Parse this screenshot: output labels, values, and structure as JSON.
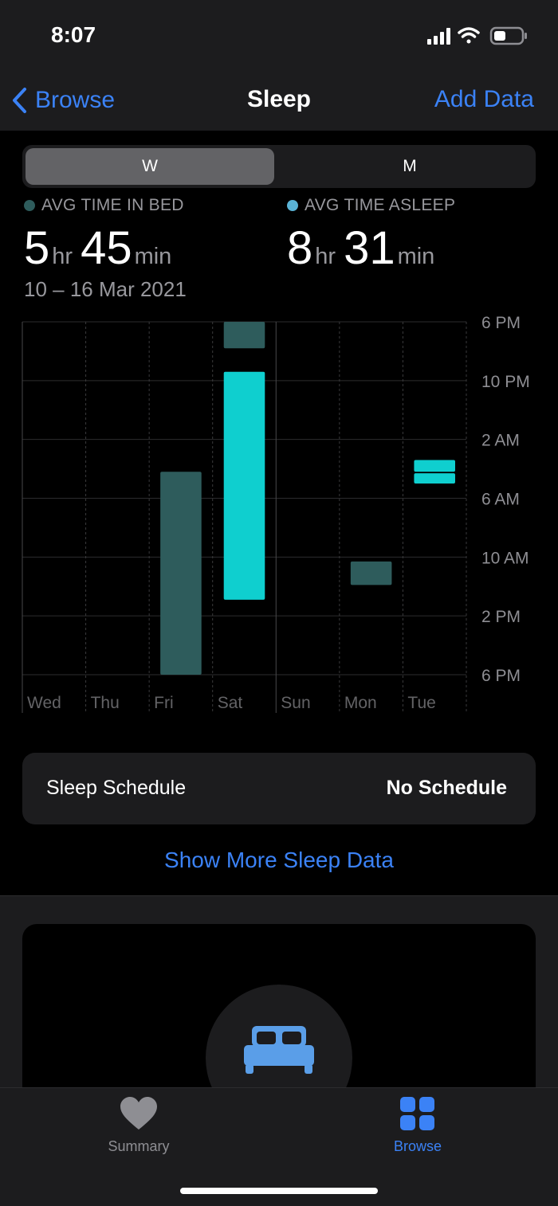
{
  "status": {
    "time": "8:07"
  },
  "nav": {
    "back_label": "Browse",
    "title": "Sleep",
    "action_label": "Add Data"
  },
  "segment": {
    "week": "W",
    "month": "M"
  },
  "stats": {
    "in_bed": {
      "label": "AVG TIME IN BED",
      "hours": "5",
      "hours_unit": "hr",
      "minutes": "45",
      "minutes_unit": "min",
      "color": "#2e5c5c"
    },
    "asleep": {
      "label": "AVG TIME ASLEEP",
      "hours": "8",
      "hours_unit": "hr",
      "minutes": "31",
      "minutes_unit": "min",
      "color": "#5ab3d6"
    }
  },
  "date_range": "10 – 16 Mar 2021",
  "chart_data": {
    "type": "bar",
    "categories": [
      "Wed",
      "Thu",
      "Fri",
      "Sat",
      "Sun",
      "Mon",
      "Tue"
    ],
    "y_ticks": [
      "6 PM",
      "10 PM",
      "2 AM",
      "6 AM",
      "10 AM",
      "2 PM",
      "6 PM"
    ],
    "y_range_hours_from_6pm": [
      0,
      24
    ],
    "series": [
      {
        "color": "#2e5c5c",
        "bars": [
          {
            "day": "Fri",
            "start": 10.2,
            "end": 24
          },
          {
            "day": "Sat",
            "start": 0,
            "end": 1.8
          },
          {
            "day": "Mon",
            "start": 16.3,
            "end": 17.9
          }
        ]
      },
      {
        "color": "#0fcfcf",
        "bars": [
          {
            "day": "Sat",
            "start": 3.4,
            "end": 18.9
          },
          {
            "day": "Tue",
            "start": 9.4,
            "end": 10.2
          },
          {
            "day": "Tue",
            "start": 10.3,
            "end": 11.0
          }
        ]
      }
    ]
  },
  "schedule": {
    "label": "Sleep Schedule",
    "value": "No Schedule"
  },
  "show_more": "Show More Sleep Data",
  "tabs": {
    "summary": "Summary",
    "browse": "Browse"
  },
  "colors": {
    "accent": "#3b82f6",
    "tab_inactive": "#8e8e93"
  }
}
